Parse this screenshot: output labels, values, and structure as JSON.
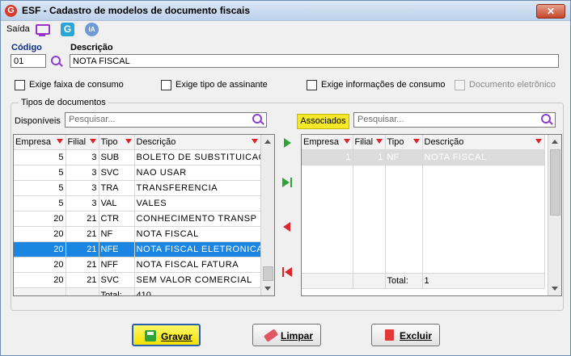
{
  "window": {
    "title": "ESF - Cadastro de modelos de documento fiscais",
    "close_symbol": "✕"
  },
  "toolbar": {
    "saida_label": "Saída",
    "g_icon_text": "G",
    "ia_icon_text": "IA"
  },
  "form": {
    "codigo_label": "Código",
    "codigo_value": "01",
    "descricao_label": "Descrição",
    "descricao_value": "NOTA FISCAL"
  },
  "checkboxes": [
    {
      "label": "Exige faixa de consumo",
      "checked": false,
      "enabled": true
    },
    {
      "label": "Exige tipo de assinante",
      "checked": false,
      "enabled": true
    },
    {
      "label": "Exige informações de consumo",
      "checked": false,
      "enabled": true
    },
    {
      "label": "Documento eletrônico",
      "checked": false,
      "enabled": false
    }
  ],
  "group": {
    "title": "Tipos de documentos",
    "disponiveis_label": "Disponíveis",
    "associados_label": "Associados",
    "search_placeholder": "Pesquisar..."
  },
  "available_table": {
    "columns": [
      "Empresa",
      "Filial",
      "Tipo",
      "Descrição"
    ],
    "rows": [
      [
        "5",
        "3",
        "SUB",
        "BOLETO DE SUBSTITUICAO"
      ],
      [
        "5",
        "3",
        "SVC",
        "NAO USAR"
      ],
      [
        "5",
        "3",
        "TRA",
        "TRANSFERENCIA"
      ],
      [
        "5",
        "3",
        "VAL",
        "VALES"
      ],
      [
        "20",
        "21",
        "CTR",
        "CONHECIMENTO TRANSP ..."
      ],
      [
        "20",
        "21",
        "NF",
        "NOTA FISCAL"
      ],
      [
        "20",
        "21",
        "NFE",
        "NOTA FISCAL ELETRONICA"
      ],
      [
        "20",
        "21",
        "NFF",
        "NOTA FISCAL FATURA"
      ],
      [
        "20",
        "21",
        "SVC",
        "SEM VALOR COMERCIAL"
      ]
    ],
    "selected_row": 6,
    "total_label": "Total:",
    "total_value": "410"
  },
  "associated_table": {
    "columns": [
      "Empresa",
      "Filial",
      "Tipo",
      "Descrição"
    ],
    "rows": [
      [
        "1",
        "1",
        "NF",
        "NOTA FISCAL"
      ]
    ],
    "total_label": "Total:",
    "total_value": "1"
  },
  "buttons": {
    "gravar": "Gravar",
    "limpar": "Limpar",
    "excluir": "Excluir"
  },
  "colors": {
    "selection": "#1a86e2",
    "associados_highlight": "#f5e82a",
    "filter_icon": "#d8262a",
    "gravar_bg": "#f2e200"
  }
}
